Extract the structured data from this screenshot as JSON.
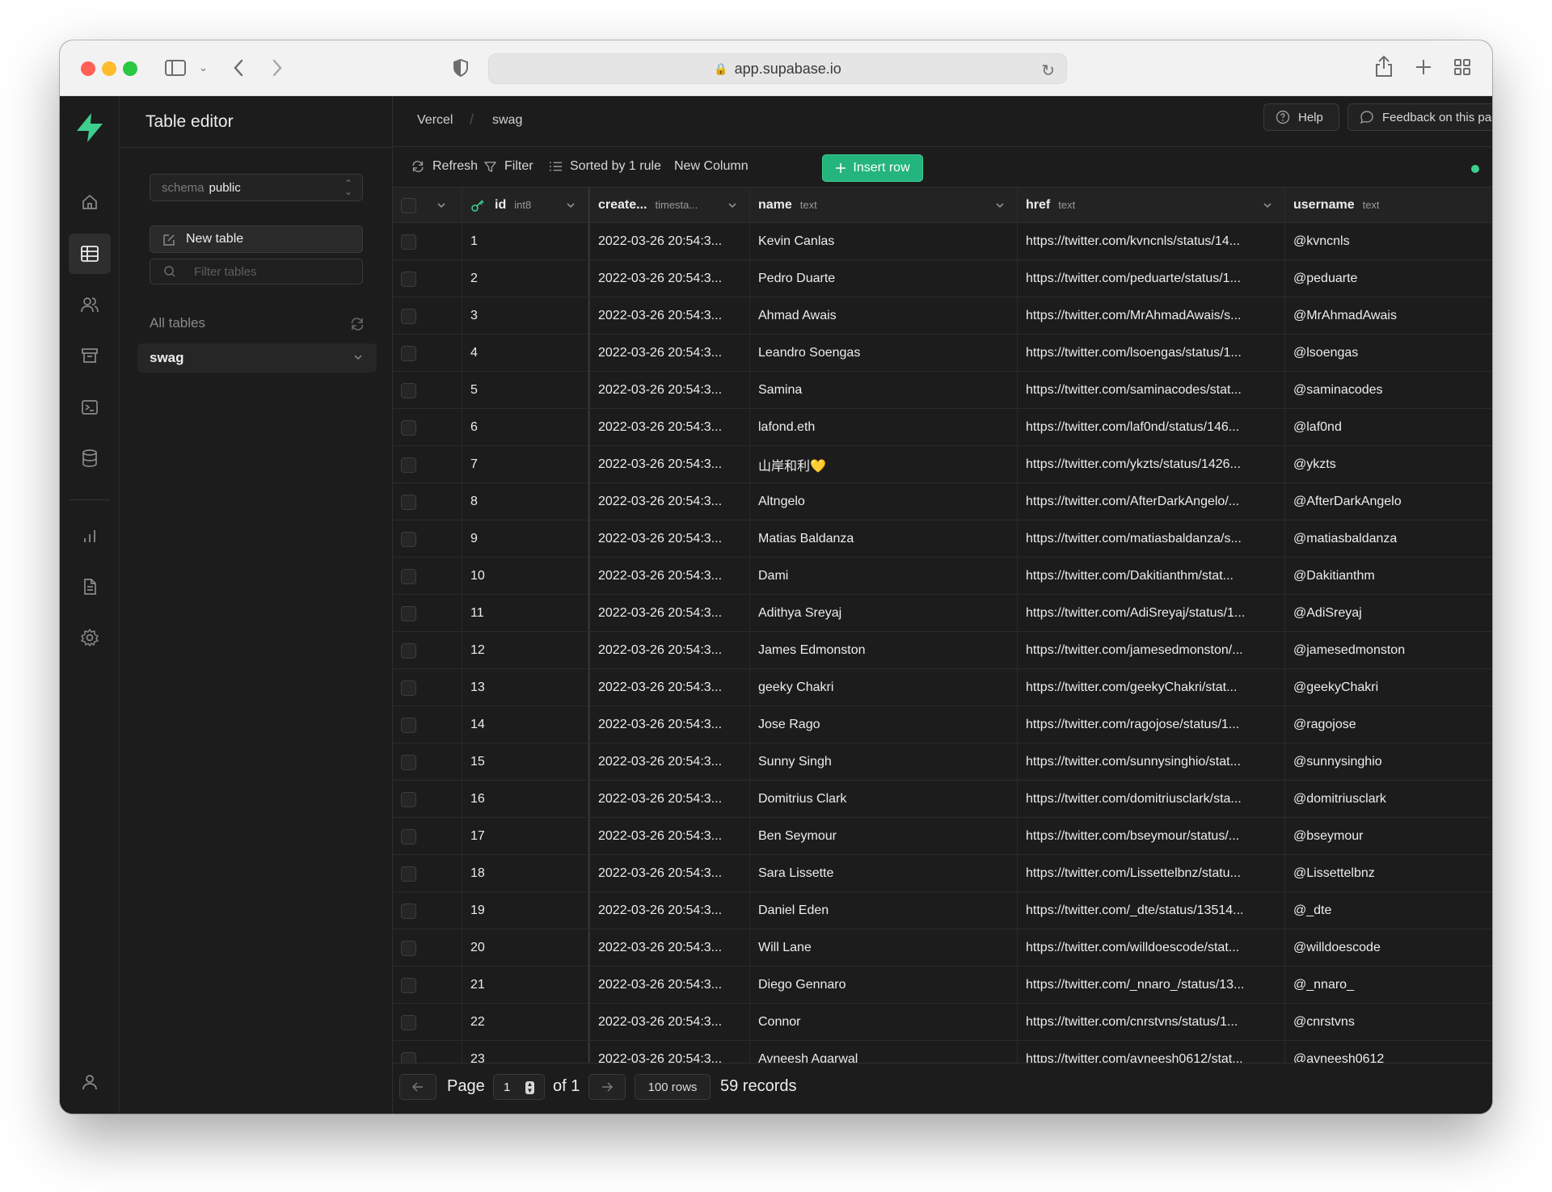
{
  "browser": {
    "url": "app.supabase.io"
  },
  "panel": {
    "title": "Table editor",
    "schema_key": "schema",
    "schema_value": "public",
    "new_table_label": "New table",
    "filter_placeholder": "Filter tables",
    "all_tables_label": "All tables",
    "selected_table": "swag"
  },
  "topbar": {
    "breadcrumb": [
      "Vercel",
      "swag"
    ],
    "help_label": "Help",
    "feedback_label": "Feedback on this page?"
  },
  "toolbar": {
    "refresh_label": "Refresh",
    "filter_label": "Filter",
    "sort_label": "Sorted by 1 rule",
    "new_column_label": "New Column",
    "insert_row_label": "Insert row"
  },
  "columns": [
    {
      "name": "id",
      "type": "int8"
    },
    {
      "name": "create...",
      "type": "timesta..."
    },
    {
      "name": "name",
      "type": "text"
    },
    {
      "name": "href",
      "type": "text"
    },
    {
      "name": "username",
      "type": "text"
    }
  ],
  "rows": [
    {
      "id": "1",
      "created": "2022-03-26 20:54:3...",
      "name": "Kevin Canlas",
      "href": "https://twitter.com/kvncnls/status/14...",
      "username": "@kvncnls"
    },
    {
      "id": "2",
      "created": "2022-03-26 20:54:3...",
      "name": "Pedro Duarte",
      "href": "https://twitter.com/peduarte/status/1...",
      "username": "@peduarte"
    },
    {
      "id": "3",
      "created": "2022-03-26 20:54:3...",
      "name": "Ahmad Awais",
      "href": "https://twitter.com/MrAhmadAwais/s...",
      "username": "@MrAhmadAwais"
    },
    {
      "id": "4",
      "created": "2022-03-26 20:54:3...",
      "name": "Leandro Soengas",
      "href": "https://twitter.com/lsoengas/status/1...",
      "username": "@lsoengas"
    },
    {
      "id": "5",
      "created": "2022-03-26 20:54:3...",
      "name": "Samina",
      "href": "https://twitter.com/saminacodes/stat...",
      "username": "@saminacodes"
    },
    {
      "id": "6",
      "created": "2022-03-26 20:54:3...",
      "name": "lafond.eth",
      "href": "https://twitter.com/laf0nd/status/146...",
      "username": "@laf0nd"
    },
    {
      "id": "7",
      "created": "2022-03-26 20:54:3...",
      "name": "山岸和利💛",
      "href": "https://twitter.com/ykzts/status/1426...",
      "username": "@ykzts"
    },
    {
      "id": "8",
      "created": "2022-03-26 20:54:3...",
      "name": "Altngelo",
      "href": "https://twitter.com/AfterDarkAngelo/...",
      "username": "@AfterDarkAngelo"
    },
    {
      "id": "9",
      "created": "2022-03-26 20:54:3...",
      "name": "Matias Baldanza",
      "href": "https://twitter.com/matiasbaldanza/s...",
      "username": "@matiasbaldanza"
    },
    {
      "id": "10",
      "created": "2022-03-26 20:54:3...",
      "name": "Dami",
      "href": "https://twitter.com/Dakitianthm/stat...",
      "username": "@Dakitianthm"
    },
    {
      "id": "11",
      "created": "2022-03-26 20:54:3...",
      "name": "Adithya Sreyaj",
      "href": "https://twitter.com/AdiSreyaj/status/1...",
      "username": "@AdiSreyaj"
    },
    {
      "id": "12",
      "created": "2022-03-26 20:54:3...",
      "name": "James Edmonston",
      "href": "https://twitter.com/jamesedmonston/...",
      "username": "@jamesedmonston"
    },
    {
      "id": "13",
      "created": "2022-03-26 20:54:3...",
      "name": "geeky Chakri",
      "href": "https://twitter.com/geekyChakri/stat...",
      "username": "@geekyChakri"
    },
    {
      "id": "14",
      "created": "2022-03-26 20:54:3...",
      "name": "Jose Rago",
      "href": "https://twitter.com/ragojose/status/1...",
      "username": "@ragojose"
    },
    {
      "id": "15",
      "created": "2022-03-26 20:54:3...",
      "name": "Sunny Singh",
      "href": "https://twitter.com/sunnysinghio/stat...",
      "username": "@sunnysinghio"
    },
    {
      "id": "16",
      "created": "2022-03-26 20:54:3...",
      "name": "Domitrius Clark",
      "href": "https://twitter.com/domitriusclark/sta...",
      "username": "@domitriusclark"
    },
    {
      "id": "17",
      "created": "2022-03-26 20:54:3...",
      "name": "Ben Seymour",
      "href": "https://twitter.com/bseymour/status/...",
      "username": "@bseymour"
    },
    {
      "id": "18",
      "created": "2022-03-26 20:54:3...",
      "name": "Sara Lissette",
      "href": "https://twitter.com/Lissettelbnz/statu...",
      "username": "@Lissettelbnz"
    },
    {
      "id": "19",
      "created": "2022-03-26 20:54:3...",
      "name": "Daniel Eden",
      "href": "https://twitter.com/_dte/status/13514...",
      "username": "@_dte"
    },
    {
      "id": "20",
      "created": "2022-03-26 20:54:3...",
      "name": "Will Lane",
      "href": "https://twitter.com/willdoescode/stat...",
      "username": "@willdoescode"
    },
    {
      "id": "21",
      "created": "2022-03-26 20:54:3...",
      "name": "Diego Gennaro",
      "href": "https://twitter.com/_nnaro_/status/13...",
      "username": "@_nnaro_"
    },
    {
      "id": "22",
      "created": "2022-03-26 20:54:3...",
      "name": "Connor",
      "href": "https://twitter.com/cnrstvns/status/1...",
      "username": "@cnrstvns"
    },
    {
      "id": "23",
      "created": "2022-03-26 20:54:3...",
      "name": "Avneesh Agarwal",
      "href": "https://twitter.com/avneesh0612/stat...",
      "username": "@avneesh0612"
    }
  ],
  "footer": {
    "page_label": "Page",
    "page_value": "1",
    "of_label": "of 1",
    "rows_label": "100 rows",
    "records_label": "59 records"
  },
  "colors": {
    "brand_green": "#3ecf8e",
    "insert_button": "#24b47e",
    "background": "#1c1c1c"
  },
  "icons": [
    "supabase-logo",
    "home-icon",
    "table-icon",
    "users-icon",
    "archive-icon",
    "terminal-icon",
    "database-icon",
    "chart-icon",
    "document-icon",
    "gear-icon",
    "user-icon",
    "refresh-icon",
    "filter-icon",
    "sort-icon",
    "plus-icon",
    "key-icon",
    "help-icon",
    "chat-icon"
  ]
}
